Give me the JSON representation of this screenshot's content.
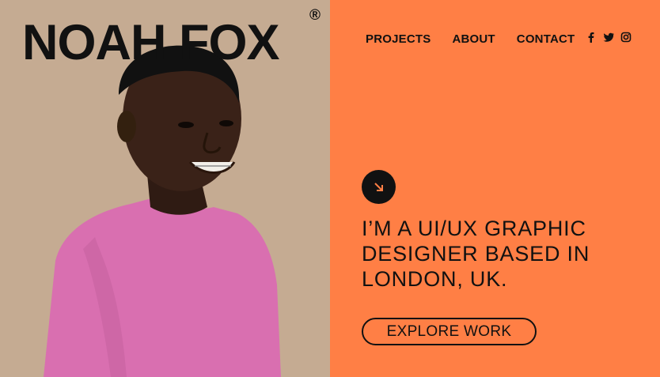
{
  "brand": {
    "name": "NOAH FOX",
    "registered_mark": "®"
  },
  "nav": {
    "items": [
      "PROJECTS",
      "ABOUT",
      "CONTACT"
    ]
  },
  "socials": [
    "facebook-icon",
    "twitter-icon",
    "instagram-icon"
  ],
  "hero": {
    "headline": "I’M A UI/UX GRAPHIC DESIGNER BASED IN LONDON, UK.",
    "cta_label": "EXPLORE WORK"
  },
  "colors": {
    "left_background": "#c7ae94",
    "accent_orange": "#ff7f45",
    "text": "#111111",
    "shirt": "#d96fb0",
    "skin": "#3a2218"
  }
}
